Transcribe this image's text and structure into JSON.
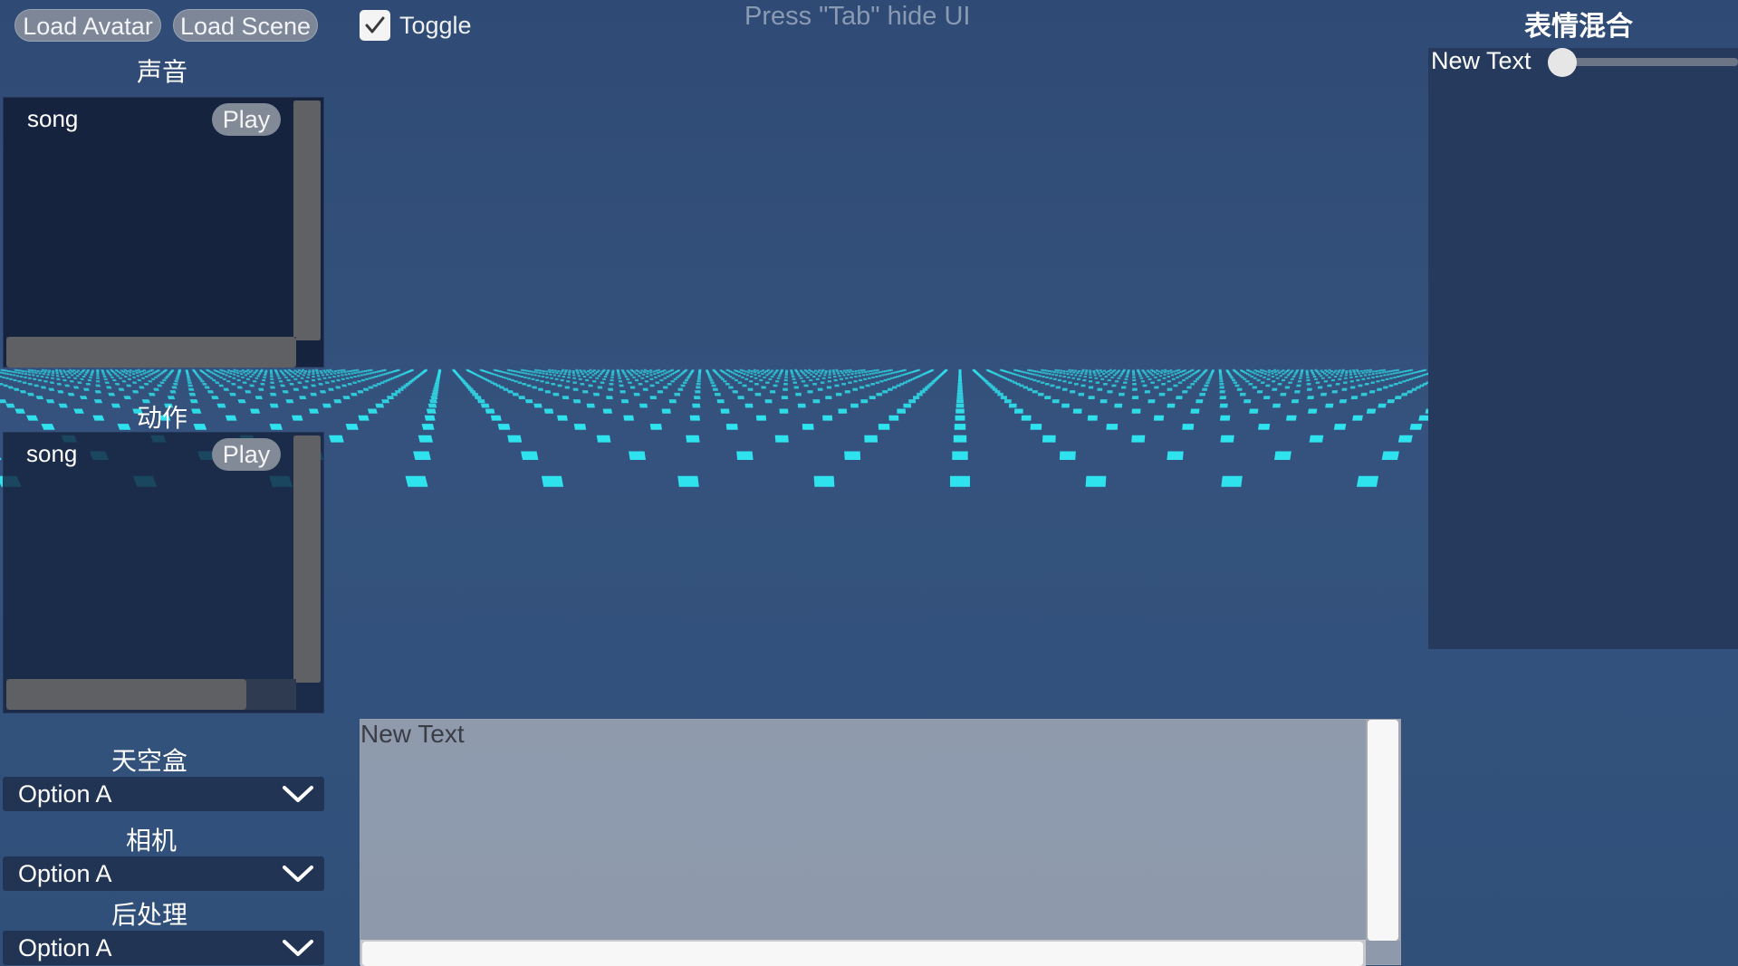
{
  "toolbar": {
    "load_avatar": "Load Avatar",
    "load_scene": "Load Scene",
    "toggle_label": "Toggle",
    "toggle_checked": true
  },
  "hint": "Press \"Tab\" hide UI",
  "sound": {
    "title": "声音",
    "items": [
      {
        "name": "song",
        "play_label": "Play"
      }
    ]
  },
  "motion": {
    "title": "动作",
    "items": [
      {
        "name": "song",
        "play_label": "Play"
      }
    ]
  },
  "skybox": {
    "title": "天空盒",
    "value": "Option A"
  },
  "camera": {
    "title": "相机",
    "value": "Option A"
  },
  "postprocess": {
    "title": "后处理",
    "value": "Option A"
  },
  "blend": {
    "title": "表情混合",
    "rows": [
      {
        "label": "New Text",
        "value": 0
      }
    ]
  },
  "textarea": {
    "label": "New Text"
  },
  "colors": {
    "background": "#31507a",
    "grid_dots": "#2fe3ee",
    "panel_dark": "#16233f",
    "button": "#7d8798"
  }
}
